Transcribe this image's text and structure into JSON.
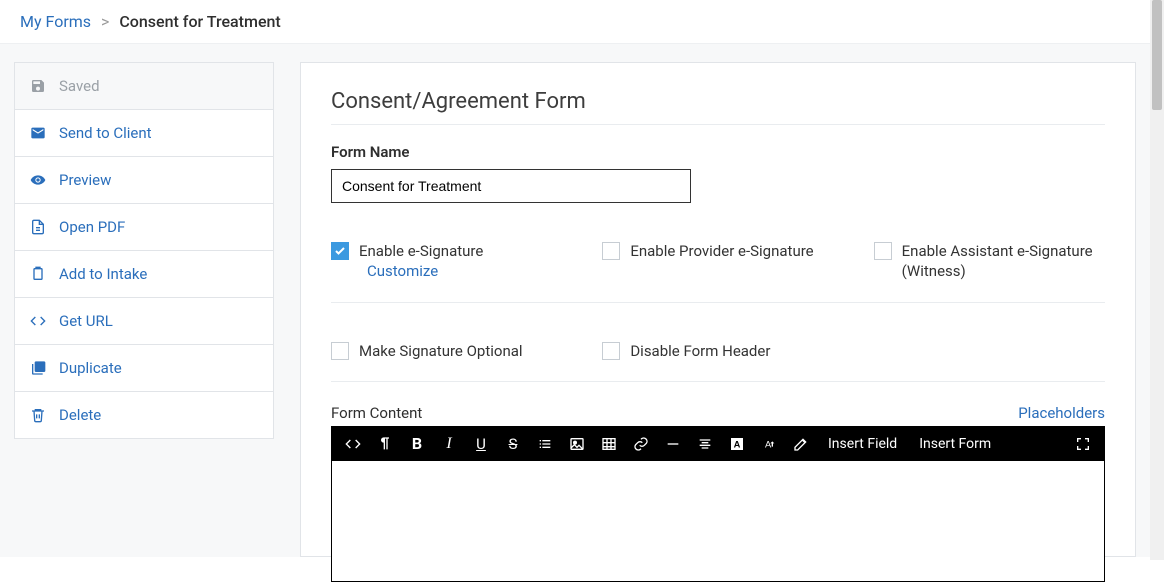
{
  "breadcrumb": {
    "root": "My Forms",
    "sep": ">",
    "current": "Consent for Treatment"
  },
  "sidebar": {
    "saved": "Saved",
    "send": "Send to Client",
    "preview": "Preview",
    "openpdf": "Open PDF",
    "addintake": "Add to Intake",
    "geturl": "Get URL",
    "duplicate": "Duplicate",
    "delete": "Delete"
  },
  "form": {
    "heading": "Consent/Agreement Form",
    "name_label": "Form Name",
    "name_value": "Consent for Treatment",
    "opt_esig": "Enable e-Signature",
    "opt_esig_customize": "Customize",
    "opt_provider_esig": "Enable Provider e-Signature",
    "opt_assistant_esig": "Enable Assistant e-Signature (Witness)",
    "opt_sig_optional": "Make Signature Optional",
    "opt_disable_header": "Disable Form Header",
    "content_label": "Form Content",
    "placeholders_link": "Placeholders"
  },
  "toolbar": {
    "insert_field": "Insert Field",
    "insert_form": "Insert Form"
  }
}
